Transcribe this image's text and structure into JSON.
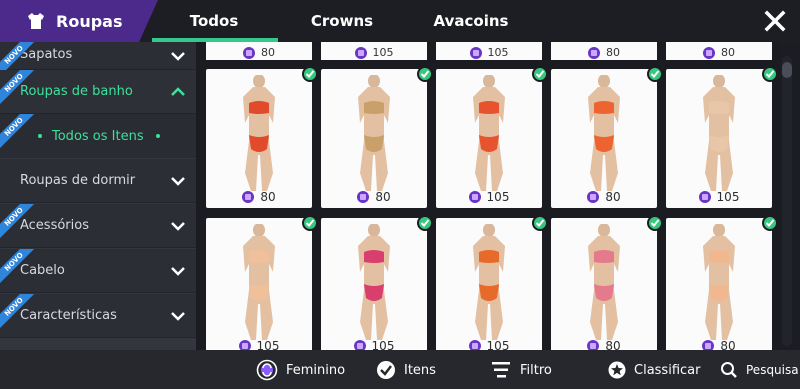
{
  "header": {
    "title": "Roupas",
    "tabs": [
      "Todos",
      "Crowns",
      "Avacoins"
    ],
    "active_tab": "Todos"
  },
  "sidebar": {
    "items": [
      {
        "label": "Sapatos",
        "novo": true
      },
      {
        "label": "Roupas de banho",
        "novo": true,
        "expanded": true
      },
      {
        "label": "Roupas de dormir",
        "novo": false
      },
      {
        "label": "Acessórios",
        "novo": true
      },
      {
        "label": "Cabelo",
        "novo": true
      },
      {
        "label": "Características",
        "novo": true
      }
    ],
    "sub_item": "Todos os Itens",
    "novo_label": "NOVO"
  },
  "grid": {
    "top_prices": [
      "80",
      "105",
      "105",
      "80",
      "80"
    ],
    "row1": [
      {
        "price": "80",
        "owned": true,
        "color": "#e24a2c"
      },
      {
        "price": "80",
        "owned": true,
        "color": "#caa06a"
      },
      {
        "price": "105",
        "owned": true,
        "color": "#e8532f"
      },
      {
        "price": "80",
        "owned": true,
        "color": "#ee6431"
      },
      {
        "price": "105",
        "owned": true,
        "color": "#e8c7a8"
      }
    ],
    "row2": [
      {
        "price": "105",
        "owned": true,
        "color": "#f0c09a"
      },
      {
        "price": "105",
        "owned": true,
        "color": "#d93f6e"
      },
      {
        "price": "105",
        "owned": true,
        "color": "#e86a2b"
      },
      {
        "price": "80",
        "owned": true,
        "color": "#e57a8c"
      },
      {
        "price": "80",
        "owned": true,
        "color": "#f1b78e"
      }
    ]
  },
  "bottombar": {
    "gender": "Feminino",
    "items": "Itens",
    "filter": "Filtro",
    "sort": "Classificar",
    "search": "Pesquisa"
  },
  "colors": {
    "accent": "#36c88a",
    "brand": "#4b2a8c",
    "coin": "#6a34c6"
  }
}
